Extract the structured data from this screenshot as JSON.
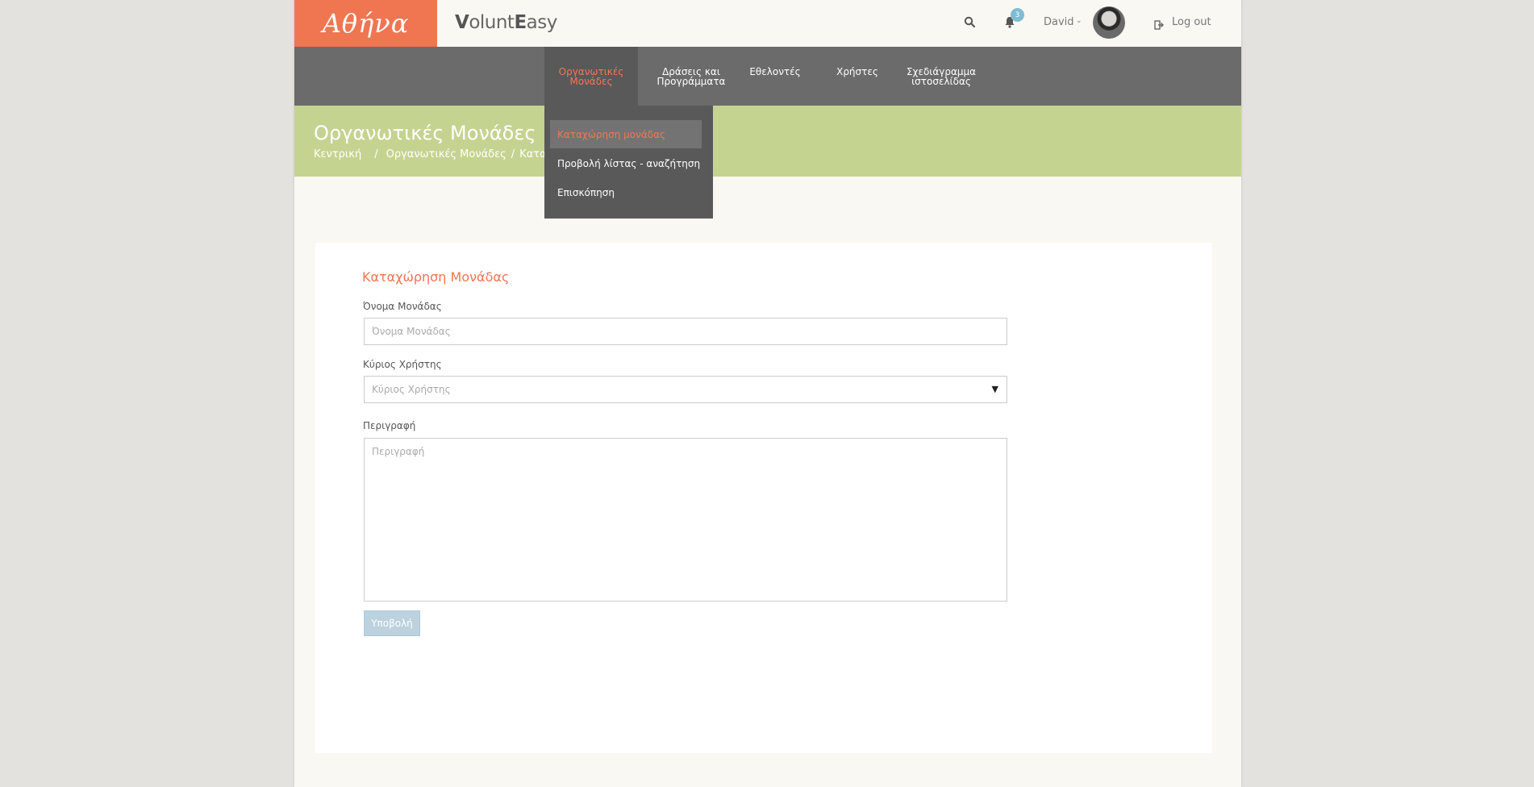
{
  "header": {
    "logo_text": "Αθήνα",
    "brand_prefix_bold": "V",
    "brand_mid": "olunt",
    "brand_bold2": "E",
    "brand_suffix": "asy",
    "notifications_count": "3",
    "user_name": "David",
    "logout_label": "Log out"
  },
  "nav": {
    "items": [
      {
        "line1": "Οργανωτικές",
        "line2": "Μονάδες"
      },
      {
        "line1": "Δράσεις και",
        "line2": "Προγράμματα"
      },
      {
        "line1": "Εθελοντές",
        "line2": ""
      },
      {
        "line1": "Χρήστες",
        "line2": ""
      },
      {
        "line1": "Σχεδιάγραμμα",
        "line2": "ιστοσελίδας"
      }
    ]
  },
  "dropdown": {
    "items": [
      "Καταχώρηση μονάδας",
      "Προβολή λίστας - αναζήτηση",
      "Επισκόπηση"
    ]
  },
  "page": {
    "title": "Οργανωτικές Μονάδες",
    "breadcrumb": [
      "Κεντρική",
      "Οργανωτικές Μονάδες",
      "Καταχώ"
    ]
  },
  "form": {
    "title": "Καταχώρηση Μονάδας",
    "name_label": "Όνομα Μονάδας",
    "name_placeholder": "Όνομα Μονάδας",
    "owner_label": "Κύριος Χρήστης",
    "owner_placeholder": "Κύριος Χρήστης",
    "desc_label": "Περιγραφή",
    "desc_placeholder": "Περιγραφή",
    "submit_label": "Υποβολή"
  },
  "colors": {
    "accent": "#ef7651",
    "nav_bg": "#6b6b6b",
    "band_bg": "#c5d391"
  }
}
